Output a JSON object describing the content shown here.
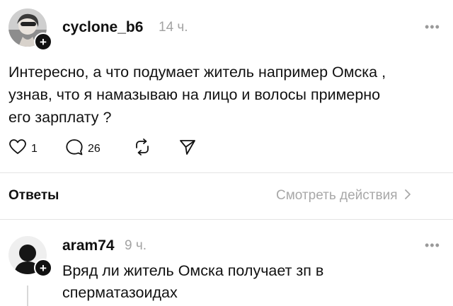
{
  "post": {
    "username": "cyclone_b6",
    "time": "14 ч.",
    "more_icon": "more-dots-icon",
    "text_lines": [
      "Интересно, а что подумает житель например Омска ,",
      "узнав,  что я намазываю на лицо и волосы примерно",
      "его зарплату ?"
    ],
    "actions": {
      "likes": "1",
      "replies": "26"
    }
  },
  "replies_section": {
    "title": "Ответы",
    "view_activity": "Смотреть действия"
  },
  "reply": {
    "username": "aram74",
    "time": "9 ч.",
    "text_lines": [
      "Вряд ли житель Омска получает зп в",
      "сперматазоидах"
    ]
  },
  "colors": {
    "text": "#111111",
    "muted": "#a3a3a3",
    "divider": "#e4e4e4"
  }
}
